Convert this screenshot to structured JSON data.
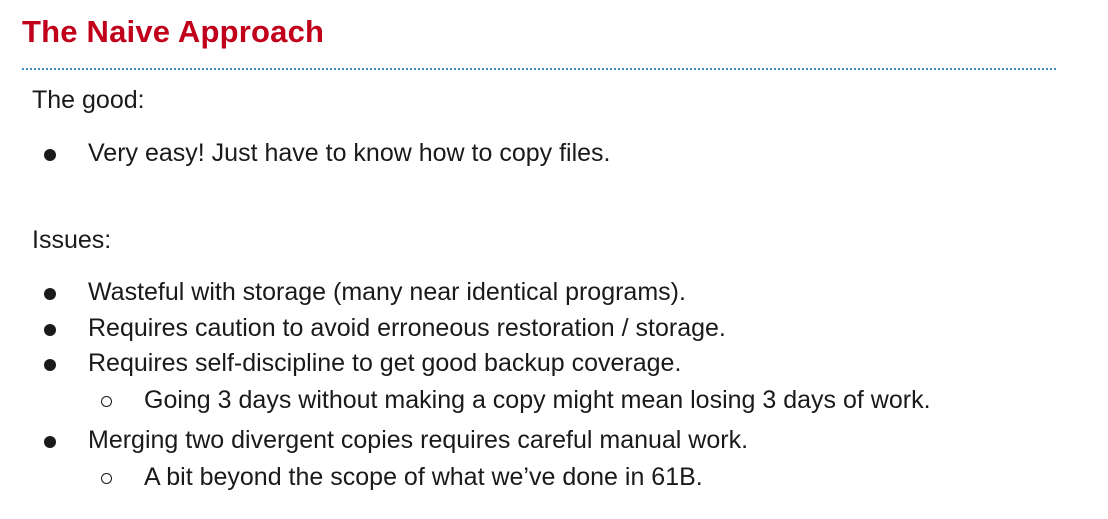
{
  "slide": {
    "title": "The Naive Approach",
    "good": {
      "heading": "The good:",
      "items": [
        "Very easy! Just have to know how to copy files."
      ]
    },
    "issues": {
      "heading": "Issues:",
      "items": [
        "Wasteful with storage (many near identical programs).",
        "Requires caution to avoid erroneous restoration / storage.",
        "Requires self-discipline to get good backup coverage.",
        "Merging two divergent copies requires careful manual work."
      ],
      "subitems": [
        "Going 3 days without making a copy might mean losing 3 days of work.",
        "A bit beyond the scope of what we’ve done in 61B."
      ]
    },
    "colors": {
      "title": "#c0001a",
      "divider": "#3a8fd0",
      "text": "#1a1a1a"
    }
  }
}
